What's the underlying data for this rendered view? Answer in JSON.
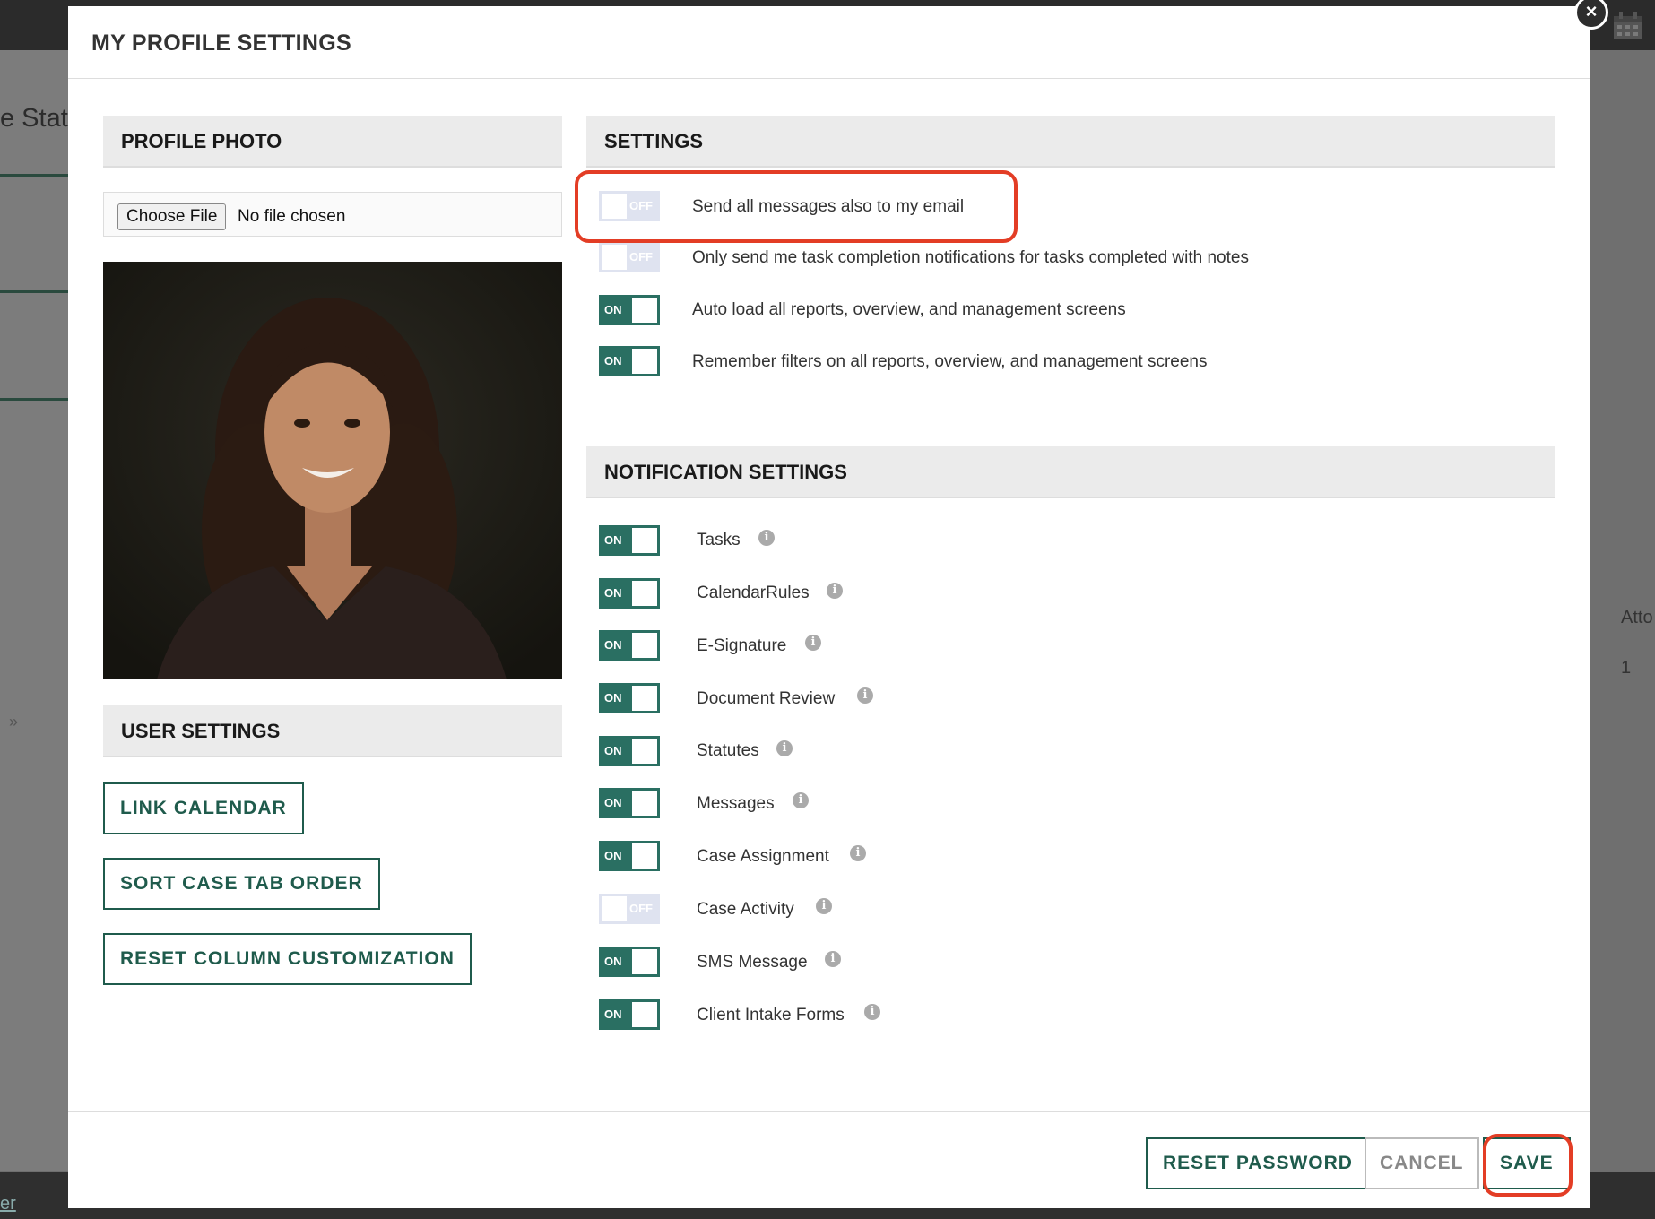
{
  "background": {
    "statis_text": "e Statis",
    "right_header": "Atto",
    "right_value": "1",
    "bottom_link": "er",
    "chevron": "»"
  },
  "modal": {
    "title": "MY PROFILE SETTINGS",
    "close_icon": "×"
  },
  "profile_photo": {
    "heading": "PROFILE PHOTO",
    "choose_file_label": "Choose File",
    "file_status": "No file chosen"
  },
  "user_settings": {
    "heading": "USER SETTINGS",
    "link_calendar": "LINK CALENDAR",
    "sort_case_tab_order": "SORT CASE TAB ORDER",
    "reset_column_customization": "RESET COLUMN CUSTOMIZATION"
  },
  "settings": {
    "heading": "SETTINGS",
    "items": [
      {
        "label": "Send all messages also to my email",
        "state": "OFF"
      },
      {
        "label": "Only send me task completion notifications for tasks completed with notes",
        "state": "OFF"
      },
      {
        "label": "Auto load all reports, overview, and management screens",
        "state": "ON"
      },
      {
        "label": "Remember filters on all reports, overview, and management screens",
        "state": "ON"
      }
    ]
  },
  "notification_settings": {
    "heading": "NOTIFICATION SETTINGS",
    "info_glyph": "i",
    "items": [
      {
        "label": "Tasks",
        "state": "ON"
      },
      {
        "label": "CalendarRules",
        "state": "ON"
      },
      {
        "label": "E-Signature",
        "state": "ON"
      },
      {
        "label": "Document Review",
        "state": "ON"
      },
      {
        "label": "Statutes",
        "state": "ON"
      },
      {
        "label": "Messages",
        "state": "ON"
      },
      {
        "label": "Case Assignment",
        "state": "ON"
      },
      {
        "label": "Case Activity",
        "state": "OFF"
      },
      {
        "label": "SMS Message",
        "state": "ON"
      },
      {
        "label": "Client Intake Forms",
        "state": "ON"
      }
    ]
  },
  "footer": {
    "reset_password": "RESET PASSWORD",
    "cancel": "CANCEL",
    "save": "SAVE"
  },
  "colors": {
    "accent": "#1f5b4c",
    "toggle_on": "#2a6f62",
    "toggle_off": "#dfe3f0",
    "highlight": "#e33d25"
  }
}
